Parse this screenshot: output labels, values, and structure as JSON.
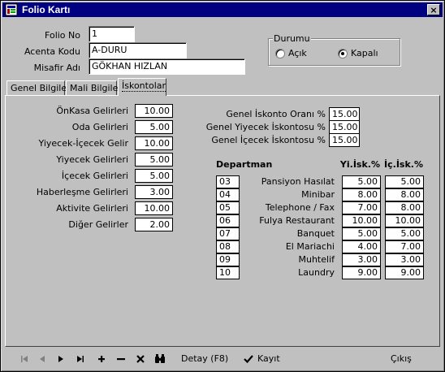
{
  "window": {
    "title": "Folio Kartı",
    "close_glyph": "×"
  },
  "form": {
    "folio_no": {
      "label": "Folio No",
      "value": "1"
    },
    "acenta_kodu": {
      "label": "Acenta Kodu",
      "value": "A-DURU"
    },
    "misafir_adi": {
      "label": "Misafir Adı",
      "value": "GÖKHAN HIZLAN"
    }
  },
  "durum": {
    "legend": "Durumu",
    "options": [
      {
        "label": "Açık",
        "selected": false
      },
      {
        "label": "Kapalı",
        "selected": true
      }
    ]
  },
  "tabs": [
    {
      "label": "Genel Bilgiler",
      "active": false
    },
    {
      "label": "Mali Bilgiler",
      "active": false
    },
    {
      "label": "İskontolar",
      "active": true
    }
  ],
  "income": [
    {
      "label": "ÖnKasa Gelirleri",
      "value": "10.00"
    },
    {
      "label": "Oda Gelirleri",
      "value": "5.00"
    },
    {
      "label": "Yiyecek-İçecek Gelir",
      "value": "10.00"
    },
    {
      "label": "Yiyecek Gelirleri",
      "value": "5.00"
    },
    {
      "label": "İçecek Gelirleri",
      "value": "5.00"
    },
    {
      "label": "Haberleşme Gelirleri",
      "value": "3.00"
    },
    {
      "label": "Aktivite Gelirleri",
      "value": "10.00"
    },
    {
      "label": "Diğer Gelirler",
      "value": "2.00"
    }
  ],
  "general": [
    {
      "label": "Genel İskonto Oranı %",
      "value": "15.00"
    },
    {
      "label": "Genel Yiyecek İskontosu %",
      "value": "15.00"
    },
    {
      "label": "Genel İçecek İskontosu %",
      "value": "15.00"
    }
  ],
  "departments": {
    "headers": {
      "dept": "Departman",
      "food": "Yi.İsk.%",
      "drink": "İç.İsk.%"
    },
    "rows": [
      {
        "code": "03",
        "name": "Pansiyon Hasılat",
        "food": "5.00",
        "drink": "5.00"
      },
      {
        "code": "04",
        "name": "Minibar",
        "food": "8.00",
        "drink": "8.00"
      },
      {
        "code": "05",
        "name": "Telephone / Fax",
        "food": "7.00",
        "drink": "8.00"
      },
      {
        "code": "06",
        "name": "Fulya Restaurant",
        "food": "10.00",
        "drink": "10.00"
      },
      {
        "code": "07",
        "name": "Banquet",
        "food": "5.00",
        "drink": "5.00"
      },
      {
        "code": "08",
        "name": "El Mariachi",
        "food": "4.00",
        "drink": "7.00"
      },
      {
        "code": "09",
        "name": "Muhtelif",
        "food": "3.00",
        "drink": "3.00"
      },
      {
        "code": "10",
        "name": "Laundry",
        "food": "9.00",
        "drink": "9.00"
      }
    ]
  },
  "toolbar": {
    "nav": [
      {
        "icon": "first-record-icon"
      },
      {
        "icon": "prior-record-icon"
      },
      {
        "icon": "next-record-icon"
      },
      {
        "icon": "last-record-icon"
      },
      {
        "icon": "insert-icon"
      },
      {
        "icon": "delete-icon"
      },
      {
        "icon": "cancel-icon"
      },
      {
        "icon": "binoculars-icon"
      }
    ],
    "detay": "Detay (F8)",
    "kayit": "Kayıt",
    "cikis": "Çıkış"
  }
}
